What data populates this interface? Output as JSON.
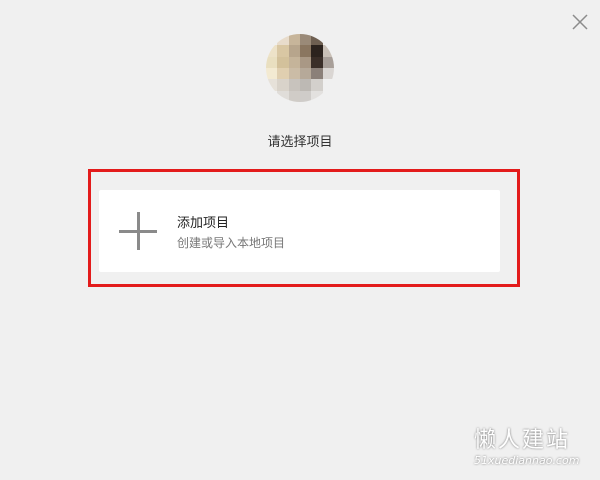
{
  "window": {
    "close_icon": "close-icon"
  },
  "avatar": {
    "alt": "pixelated-avatar",
    "pixels": [
      "#f0f0f0",
      "#e8dccb",
      "#c7b59a",
      "#9a8a78",
      "#6e5f51",
      "#f0f0f0",
      "#ede2c8",
      "#d9c7a3",
      "#b7a58c",
      "#8a7660",
      "#2c231e",
      "#c9c0b7",
      "#e9dfc0",
      "#d3c19b",
      "#c5b49a",
      "#a99885",
      "#3a2e28",
      "#a89f99",
      "#f3ead2",
      "#e0cfb0",
      "#cbbca6",
      "#b6a999",
      "#8b8079",
      "#dad6d3",
      "#e6e1d9",
      "#d9d3ca",
      "#c8c3bd",
      "#bdb9b4",
      "#d3d0cc",
      "#f0f0f0",
      "#f0f0f0",
      "#e0ddd9",
      "#d0ccc7",
      "#cfccc9",
      "#e3e1df",
      "#f0f0f0"
    ]
  },
  "prompt": {
    "text": "请选择项目"
  },
  "add_project": {
    "icon": "plus-icon",
    "title": "添加项目",
    "subtitle": "创建或导入本地项目"
  },
  "watermark": {
    "title": "懒人建站",
    "url": "51xuediannao.com"
  },
  "colors": {
    "background": "#f0f0f0",
    "card": "#ffffff",
    "highlight_border": "#e31b1b",
    "icon": "#8a8a8a"
  }
}
